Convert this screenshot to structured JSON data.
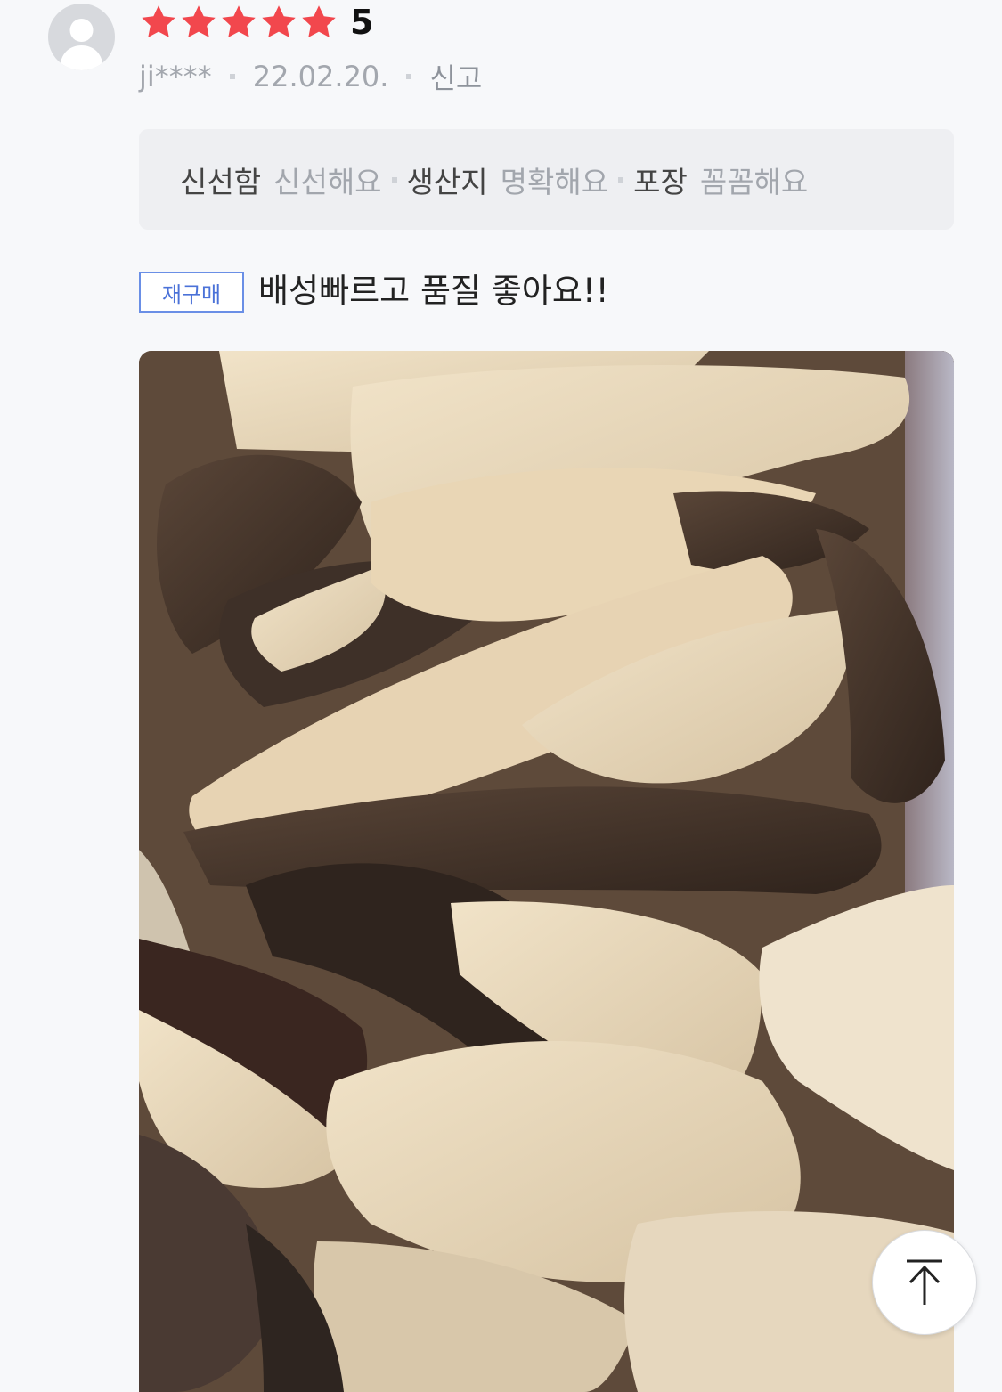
{
  "review": {
    "rating": 5,
    "score_text": "5",
    "user": "ji****",
    "date": "22.02.20.",
    "report_label": "신고",
    "tags": [
      {
        "key": "신선함",
        "value": "신선해요"
      },
      {
        "key": "생산지",
        "value": "명확해요"
      },
      {
        "key": "포장",
        "value": "꼼꼼해요"
      }
    ],
    "badge": "재구매",
    "text": "배성빠르고 품질 좋아요!!"
  },
  "colors": {
    "star": "#f2474d",
    "badge": "#4b72d8",
    "background": "#f7f8fa"
  },
  "icons": {
    "avatar": "default-avatar-icon",
    "star": "star-icon",
    "scroll_top": "arrow-up-to-top-icon"
  }
}
